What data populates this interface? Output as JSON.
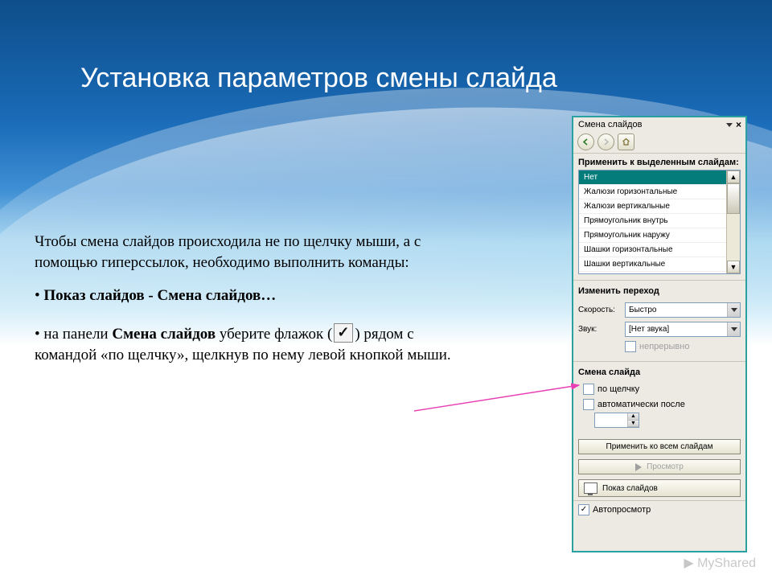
{
  "title": "Установка параметров смены слайда",
  "body": {
    "intro": "Чтобы смена слайдов происходила не по щелчку мыши, а с помощью гиперссылок, необходимо выполнить команды:",
    "bullet1_prefix": "• ",
    "bullet1": "Показ слайдов - Смена слайдов…",
    "bullet2_prefix": "• на панели ",
    "bullet2_bold": "Смена слайдов",
    "bullet2_mid": " уберите флажок (",
    "bullet2_tail": ") рядом с командой «по щелчку», щелкнув по нему левой кнопкой мыши."
  },
  "panel": {
    "title": "Смена слайдов",
    "apply_label": "Применить к выделенным слайдам:",
    "items": [
      "Нет",
      "Жалюзи горизонтальные",
      "Жалюзи вертикальные",
      "Прямоугольник внутрь",
      "Прямоугольник наружу",
      "Шашки горизонтальные",
      "Шашки вертикальные"
    ],
    "change_label": "Изменить переход",
    "speed_label": "Скорость:",
    "speed_value": "Быстро",
    "sound_label": "Звук:",
    "sound_value": "[Нет звука]",
    "continuous": "непрерывно",
    "advance_label": "Смена слайда",
    "on_click": "по щелчку",
    "auto_after": "автоматически после",
    "apply_all": "Применить ко всем слайдам",
    "preview": "Просмотр",
    "slideshow": "Показ слайдов",
    "autopreview": "Автопросмотр"
  },
  "watermark": "▶ MyShared"
}
